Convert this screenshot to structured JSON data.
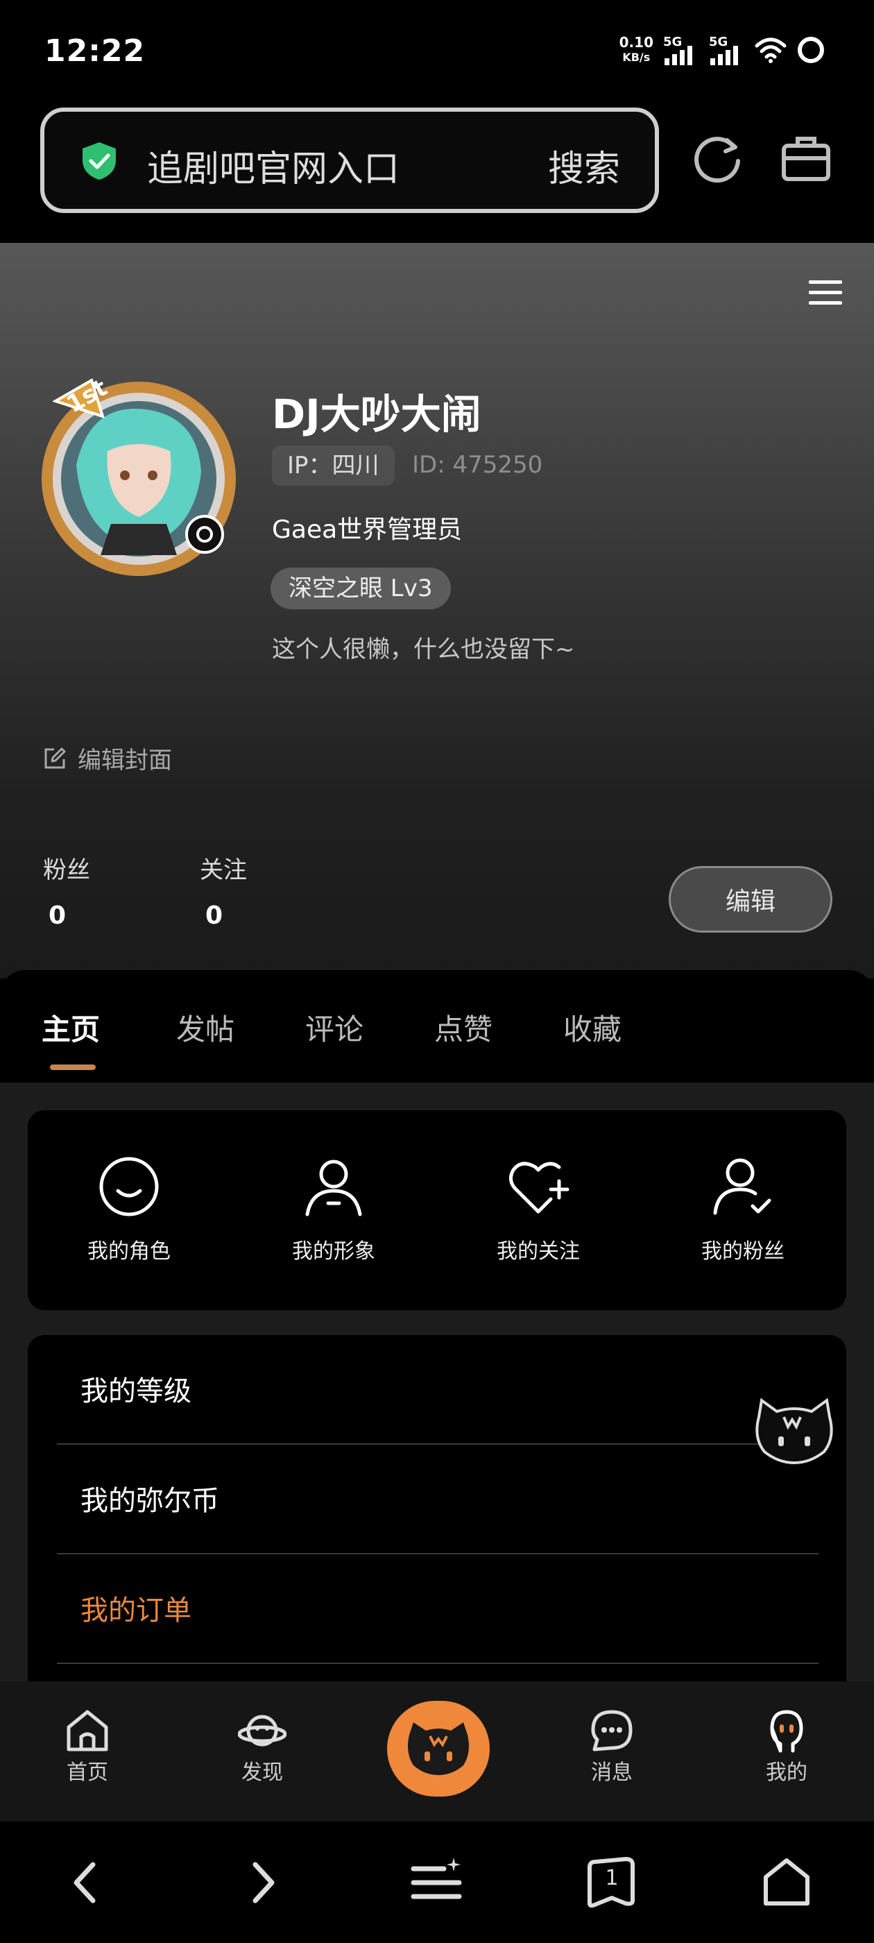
{
  "status": {
    "time": "12:22",
    "net_speed": "0.10",
    "net_unit": "KB/s",
    "sim1": "5G",
    "sim2": "5G"
  },
  "browser": {
    "url_text": "追剧吧官网入口",
    "search_label": "搜索"
  },
  "profile": {
    "username": "DJ大吵大闹",
    "ip": "IP：四川",
    "id": "ID: 475250",
    "role": "Gaea世界管理员",
    "badge": "深空之眼 Lv3",
    "bio": "这个人很懒，什么也没留下~",
    "edit_cover": "编辑封面",
    "avatar_tag": "1st",
    "fans_label": "粉丝",
    "fans_count": "0",
    "following_label": "关注",
    "following_count": "0",
    "edit_button": "编辑"
  },
  "tabs": [
    {
      "label": "主页",
      "active": true
    },
    {
      "label": "发帖",
      "active": false
    },
    {
      "label": "评论",
      "active": false
    },
    {
      "label": "点赞",
      "active": false
    },
    {
      "label": "收藏",
      "active": false
    }
  ],
  "quick_actions": [
    {
      "label": "我的角色",
      "icon": "smile-icon"
    },
    {
      "label": "我的形象",
      "icon": "user-icon"
    },
    {
      "label": "我的关注",
      "icon": "heart-plus-icon"
    },
    {
      "label": "我的粉丝",
      "icon": "user-check-icon"
    }
  ],
  "list": [
    {
      "label": "我的等级"
    },
    {
      "label": "我的弥尔币"
    },
    {
      "label": "我的订单",
      "accent": "#e8893e"
    }
  ],
  "bottom_nav": [
    {
      "label": "首页",
      "icon": "home-icon"
    },
    {
      "label": "发现",
      "icon": "planet-icon"
    },
    {
      "label": "",
      "icon": "mascot-icon"
    },
    {
      "label": "消息",
      "icon": "message-icon"
    },
    {
      "label": "我的",
      "icon": "profile-icon"
    }
  ],
  "system_nav": {
    "tab_count": "1"
  },
  "colors": {
    "accent_orange": "#f0883c",
    "shield_green": "#2fbf71"
  }
}
